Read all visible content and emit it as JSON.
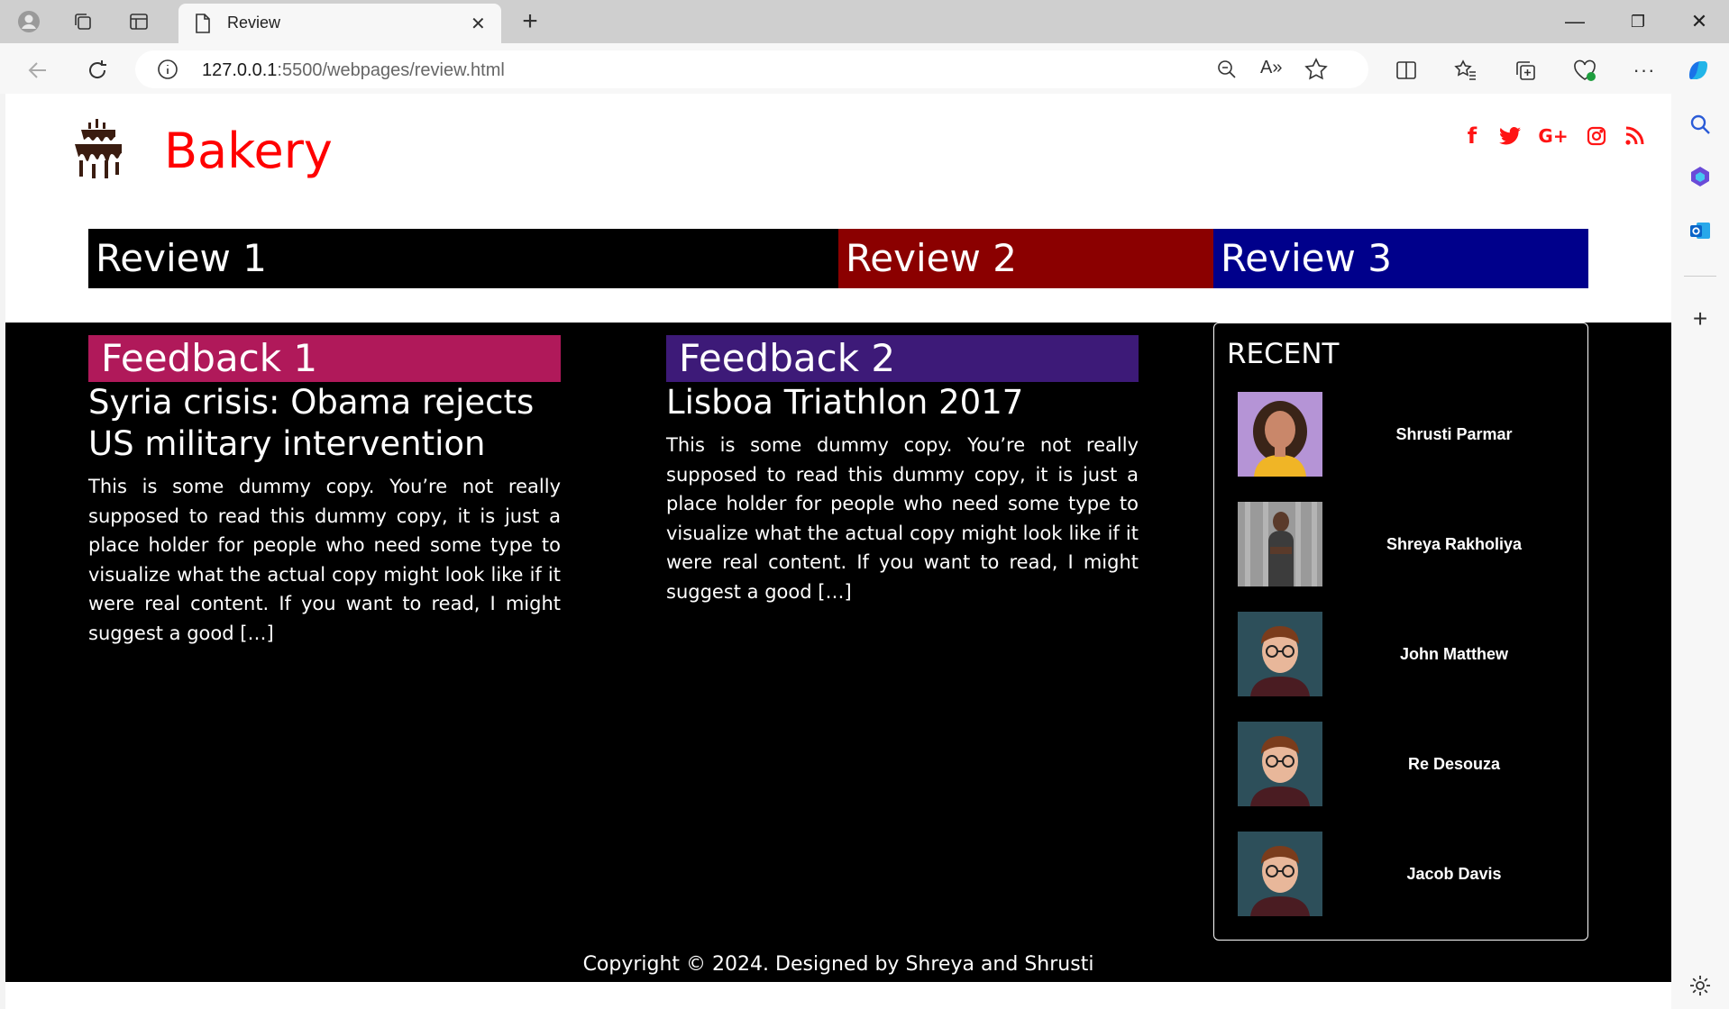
{
  "browser": {
    "tab_title": "Review",
    "url_host": "127.0.0.1",
    "url_path": ":5500/webpages/review.html",
    "new_tab_label": "+",
    "window": {
      "minimize": "—",
      "restore": "❐",
      "close": "✕"
    }
  },
  "site": {
    "brand": "Bakery",
    "social": [
      "f",
      "t",
      "G+",
      "ig",
      "rss"
    ]
  },
  "reviews_nav": [
    {
      "label": "Review 1",
      "color": "#000000"
    },
    {
      "label": "Review 2",
      "color": "#8b0000"
    },
    {
      "label": "Review 3",
      "color": "#00008b"
    }
  ],
  "feedback": [
    {
      "badge": "Feedback 1",
      "badge_color": "#b0195a",
      "title": "Syria crisis: Obama rejects US military intervention",
      "body": "This is some dummy copy. You’re not really supposed to read this dummy copy, it is just a place holder for people who need some type to visualize what the actual copy might look like if it were real content. If you want to read, I might suggest a good […]"
    },
    {
      "badge": "Feedback 2",
      "badge_color": "#3d1a78",
      "title": "Lisboa Triathlon 2017",
      "body": "This is some dummy copy. You’re not really supposed to read this dummy copy, it is just a place holder for people who need some type to visualize what the actual copy might look like if it were real content. If you want to read, I might suggest a good […]"
    }
  ],
  "recent": {
    "title": "RECENT",
    "people": [
      {
        "name": "Shrusti Parmar"
      },
      {
        "name": "Shreya Rakholiya"
      },
      {
        "name": "John Matthew"
      },
      {
        "name": "Re Desouza"
      },
      {
        "name": "Jacob Davis"
      }
    ]
  },
  "footer": {
    "copyright": "Copyright © 2024. Designed by Shreya and Shrusti"
  }
}
